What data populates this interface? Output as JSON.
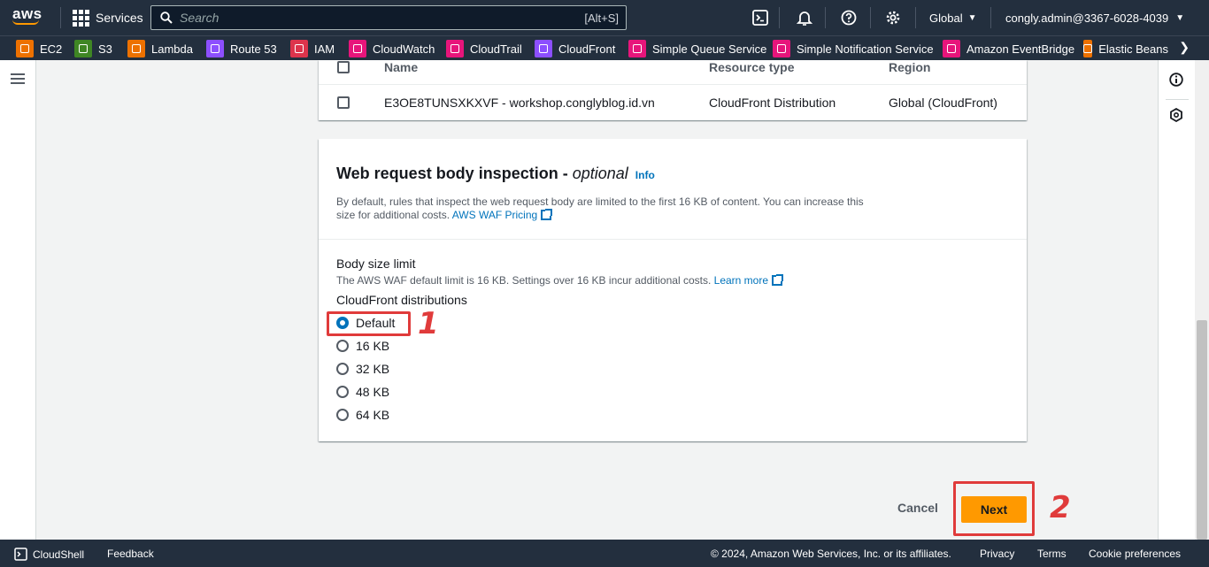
{
  "topnav": {
    "logo": "aws",
    "services_label": "Services",
    "search_placeholder": "Search",
    "search_shortcut": "[Alt+S]",
    "region": "Global",
    "account": "congly.admin@3367-6028-4039"
  },
  "favorites": [
    {
      "label": "EC2",
      "color": "#ed7100",
      "icon": "ec2-icon"
    },
    {
      "label": "S3",
      "color": "#3f8624",
      "icon": "s3-icon"
    },
    {
      "label": "Lambda",
      "color": "#ed7100",
      "icon": "lambda-icon"
    },
    {
      "label": "Route 53",
      "color": "#8c4fff",
      "icon": "route53-icon"
    },
    {
      "label": "IAM",
      "color": "#dd344c",
      "icon": "iam-icon"
    },
    {
      "label": "CloudWatch",
      "color": "#e7157b",
      "icon": "cloudwatch-icon"
    },
    {
      "label": "CloudTrail",
      "color": "#e7157b",
      "icon": "cloudtrail-icon"
    },
    {
      "label": "CloudFront",
      "color": "#8c4fff",
      "icon": "cloudfront-icon"
    },
    {
      "label": "Simple Queue Service",
      "color": "#e7157b",
      "icon": "sqs-icon"
    },
    {
      "label": "Simple Notification Service",
      "color": "#e7157b",
      "icon": "sns-icon"
    },
    {
      "label": "Amazon EventBridge",
      "color": "#e7157b",
      "icon": "eventbridge-icon"
    },
    {
      "label": "Elastic Beans",
      "color": "#ed7100",
      "icon": "elastic-beanstalk-icon"
    }
  ],
  "resources_table": {
    "headers": {
      "name": "Name",
      "type": "Resource type",
      "region": "Region"
    },
    "rows": [
      {
        "name": "E3OE8TUNSXKXVF - workshop.conglyblog.id.vn",
        "type": "CloudFront Distribution",
        "region": "Global (CloudFront)"
      }
    ]
  },
  "body_inspection": {
    "title": "Web request body inspection - ",
    "title_optional": "optional",
    "info": "Info",
    "description": "By default, rules that inspect the web request body are limited to the first 16 KB of content. You can increase this size for additional costs. ",
    "pricing_link": "AWS WAF Pricing",
    "size_label": "Body size limit",
    "size_desc": "The AWS WAF default limit is 16 KB. Settings over 16 KB incur additional costs. ",
    "learn_more": "Learn more",
    "group_label": "CloudFront distributions",
    "options": [
      "Default",
      "16 KB",
      "32 KB",
      "48 KB",
      "64 KB"
    ],
    "selected": "Default"
  },
  "annotations": {
    "step1": "1",
    "step2": "2"
  },
  "actions": {
    "cancel": "Cancel",
    "next": "Next"
  },
  "footer": {
    "cloudshell": "CloudShell",
    "feedback": "Feedback",
    "copyright": "© 2024, Amazon Web Services, Inc. or its affiliates.",
    "privacy": "Privacy",
    "terms": "Terms",
    "cookies": "Cookie preferences"
  },
  "colors": {
    "nav_bg": "#232f3e",
    "accent": "#ff9900",
    "link": "#0073bb",
    "annotation": "#e03b3b"
  }
}
